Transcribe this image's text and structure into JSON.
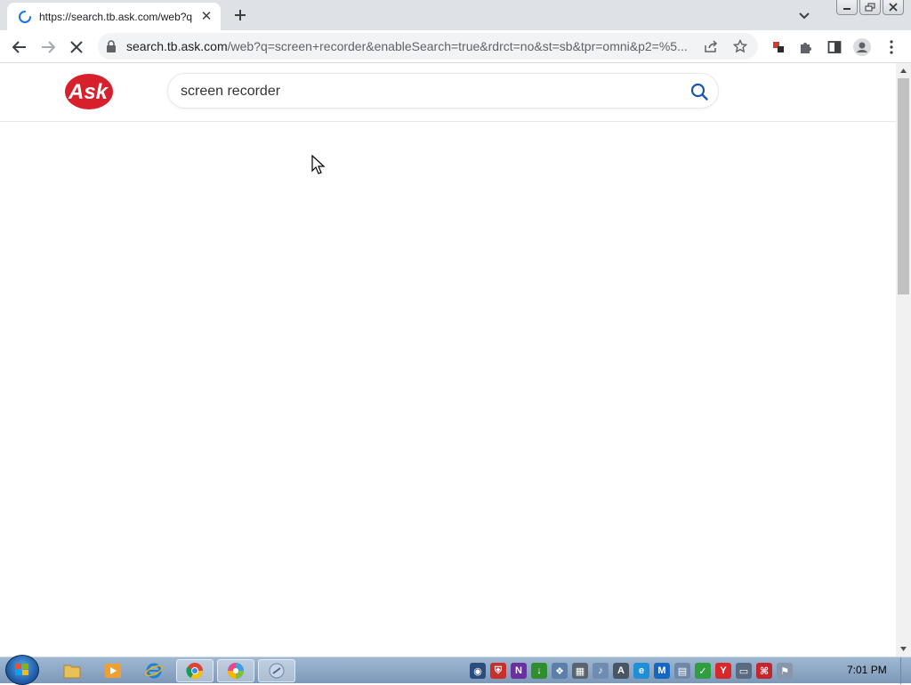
{
  "browser": {
    "tab": {
      "title": "https://search.tb.ask.com/web?q"
    },
    "address": {
      "host": "search.tb.ask.com",
      "path": "/web?q=screen+recorder&enableSearch=true&rdrct=no&st=sb&tpr=omni&p2=%5..."
    }
  },
  "page": {
    "logo_text": "Ask",
    "search": {
      "value": "screen recorder"
    }
  },
  "taskbar": {
    "clock": "7:01 PM"
  },
  "colors": {
    "ask_red": "#d7202c",
    "search_icon": "#1a56a8",
    "chrome_tabstrip": "#dee1e6",
    "omnibox": "#f1f3f4"
  },
  "icons": [
    "back-icon",
    "forward-icon",
    "stop-icon",
    "lock-icon",
    "share-icon",
    "star-icon",
    "extension-icon",
    "puzzle-icon",
    "sidepanel-icon",
    "profile-icon",
    "menu-icon",
    "search-icon"
  ]
}
